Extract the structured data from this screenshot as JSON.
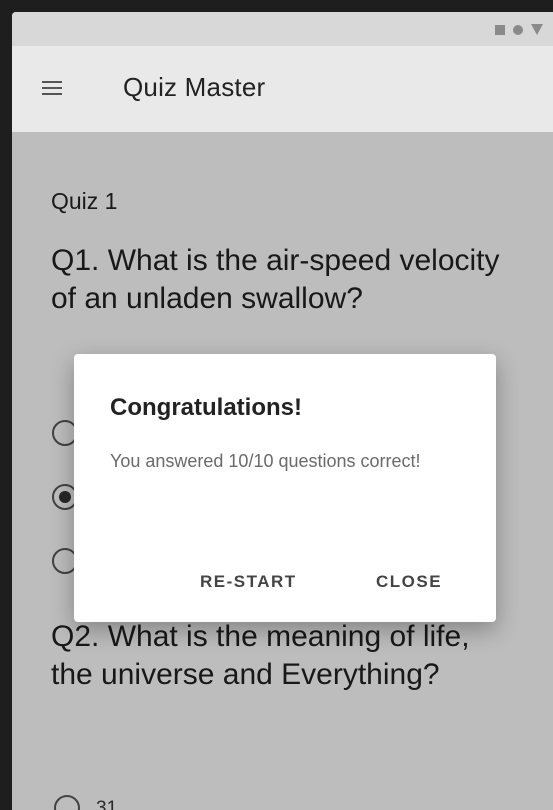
{
  "app": {
    "title": "Quiz Master"
  },
  "quiz": {
    "title": "Quiz 1",
    "questions": [
      {
        "text": "Q1. What is the air-speed velocity of an unladen swallow?",
        "options": [
          {
            "label": "",
            "selected": false
          },
          {
            "label": "",
            "selected": true
          },
          {
            "label": "",
            "selected": false
          }
        ]
      },
      {
        "text": "Q2. What is the meaning of life, the universe and Everything?",
        "options": [
          {
            "label": "31",
            "selected": false
          }
        ]
      }
    ]
  },
  "dialog": {
    "title": "Congratulations!",
    "message": "You answered 10/10 questions correct!",
    "restart_label": "RE-START",
    "close_label": "CLOSE"
  }
}
